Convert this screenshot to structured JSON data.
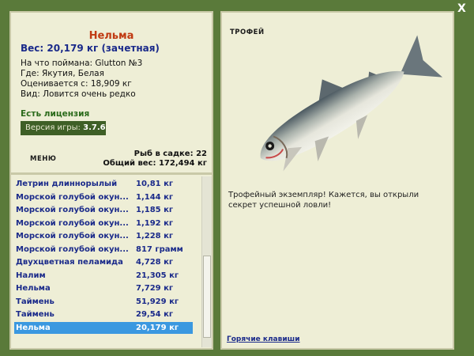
{
  "catch": {
    "name": "Нельма",
    "weight": "Вес: 20,179 кг (зачетная)",
    "lure": "На что поймана: Glutton №3",
    "place": "Где: Якутия, Белая",
    "value": "Оценивается с: 18,909 кг",
    "kind": "Вид: Ловится очень редко"
  },
  "license": "Есть лицензия",
  "version": {
    "label": "Версия игры: ",
    "number": "3.7.6"
  },
  "menu_label": "МЕНЮ",
  "cage": {
    "count": "Рыб в садке: 22",
    "total": "Общий вес: 172,494 кг"
  },
  "fish_list": [
    {
      "name": "Летрин длиннорылый",
      "weight": "10,81 кг"
    },
    {
      "name": "Морской голубой окун...",
      "weight": "1,144 кг"
    },
    {
      "name": "Морской голубой окун...",
      "weight": "1,185 кг"
    },
    {
      "name": "Морской голубой окун...",
      "weight": "1,192 кг"
    },
    {
      "name": "Морской голубой окун...",
      "weight": "1,228 кг"
    },
    {
      "name": "Морской голубой окун...",
      "weight": "817 грамм"
    },
    {
      "name": "Двухцветная пеламида",
      "weight": "4,728 кг"
    },
    {
      "name": "Налим",
      "weight": "21,305 кг"
    },
    {
      "name": "Нельма",
      "weight": "7,729 кг"
    },
    {
      "name": "Таймень",
      "weight": "51,929 кг"
    },
    {
      "name": "Таймень",
      "weight": "29,54 кг"
    },
    {
      "name": "Нельма",
      "weight": "20,179 кг"
    }
  ],
  "selected_index": 11,
  "trophy": {
    "title": "ТРОФЕЙ",
    "description": "Трофейный экземпляр! Кажется, вы открыли секрет успешной ловли!"
  },
  "hotkeys": "Горячие клавиши",
  "close_label": "X"
}
